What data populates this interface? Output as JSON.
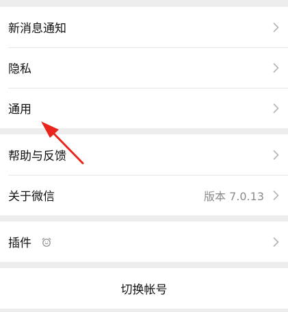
{
  "settings": {
    "group1": [
      {
        "label": "新消息通知"
      },
      {
        "label": "隐私"
      },
      {
        "label": "通用"
      }
    ],
    "group2": [
      {
        "label": "帮助与反馈"
      },
      {
        "label": "关于微信",
        "value": "版本 7.0.13"
      }
    ],
    "group3": [
      {
        "label": "插件",
        "icon": "alarm-clock-icon"
      }
    ],
    "switch_account_label": "切换帐号"
  },
  "icons": {
    "row_chevron": "chevron-right-icon",
    "annotation": "red-arrow-annotation"
  },
  "colors": {
    "background": "#ededed",
    "annotation_arrow": "#e8241c",
    "secondary_text": "#8a8a8a"
  }
}
